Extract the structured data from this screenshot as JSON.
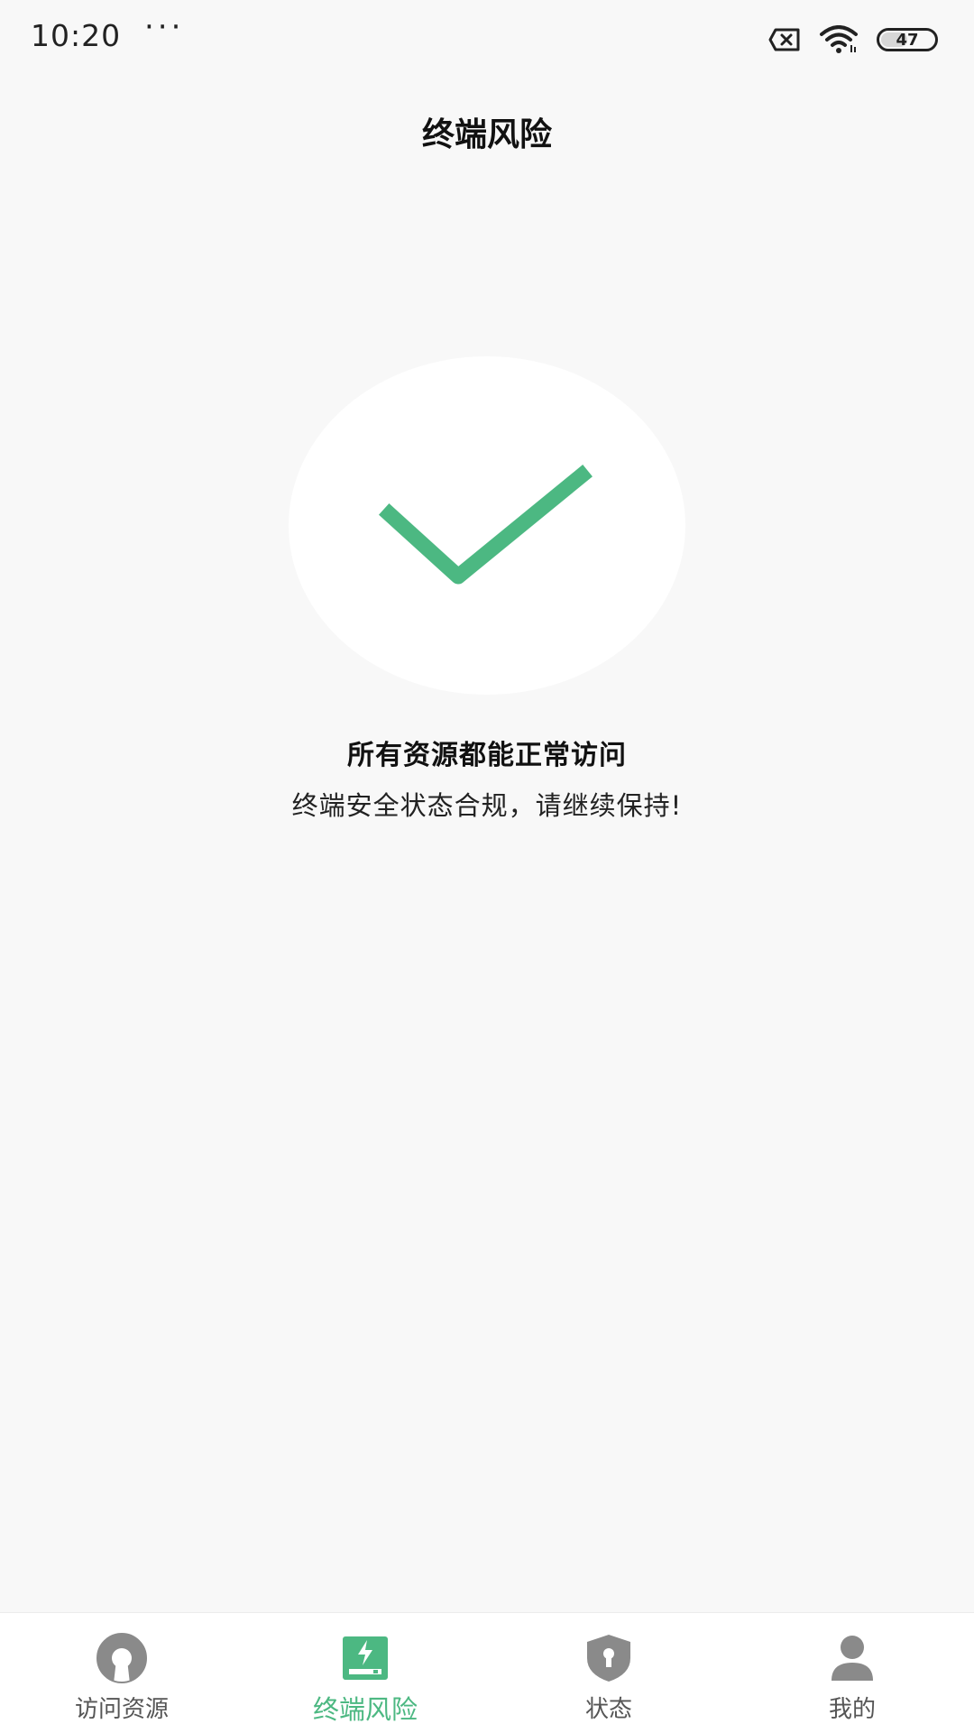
{
  "status_bar": {
    "time": "10:20",
    "dots": "···",
    "battery_level": "47"
  },
  "header": {
    "title": "终端风险"
  },
  "status": {
    "heading": "所有资源都能正常访问",
    "subtext": "终端安全状态合规，请继续保持!",
    "icon": "checkmark-icon",
    "accent_color": "#4cb882"
  },
  "bottom_nav": {
    "items": [
      {
        "label": "访问资源",
        "icon": "resource-icon",
        "active": false
      },
      {
        "label": "终端风险",
        "icon": "terminal-risk-icon",
        "active": true
      },
      {
        "label": "状态",
        "icon": "shield-lock-icon",
        "active": false
      },
      {
        "label": "我的",
        "icon": "person-icon",
        "active": false
      }
    ],
    "active_color": "#4cb882",
    "inactive_color": "#8a8a8a"
  }
}
